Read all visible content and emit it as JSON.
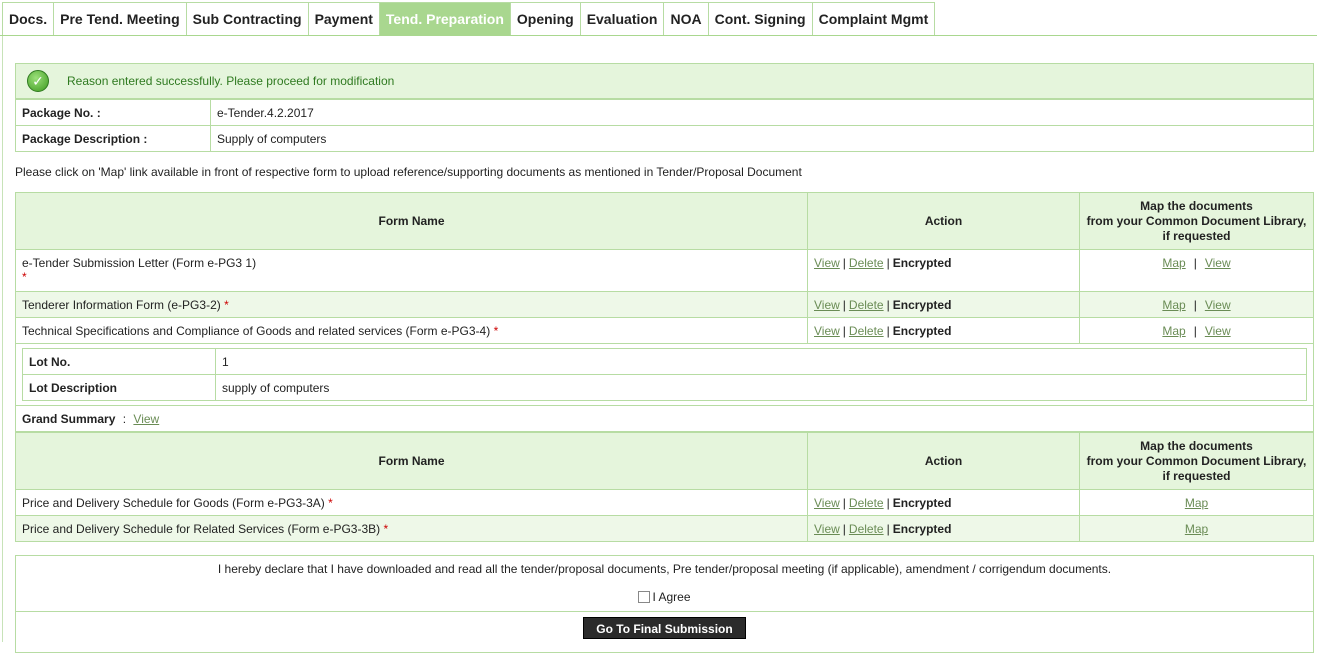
{
  "tabs": [
    "Docs.",
    "Pre Tend. Meeting",
    "Sub Contracting",
    "Payment",
    "Tend. Preparation",
    "Opening",
    "Evaluation",
    "NOA",
    "Cont. Signing",
    "Complaint Mgmt"
  ],
  "active_tab": "Tend. Preparation",
  "success_message": "Reason entered successfully. Please proceed for modification",
  "package": {
    "no_label": "Package No. :",
    "no_value": "e-Tender.4.2.2017",
    "desc_label": "Package Description :",
    "desc_value": "Supply of computers"
  },
  "instruction": "Please click on 'Map' link available in front of respective form to upload reference/supporting documents as mentioned in Tender/Proposal Document",
  "table_headers": {
    "form_name": "Form Name",
    "action": "Action",
    "map_line1": "Map the documents",
    "map_line2": "from your Common Document Library,",
    "map_line3": "if requested"
  },
  "links": {
    "view": "View",
    "delete": "Delete",
    "encrypted": "Encrypted",
    "map": "Map",
    "sep": "|",
    "required": "*"
  },
  "forms": [
    "e-Tender Submission Letter (Form e-PG3 1)",
    "Tenderer Information Form (e-PG3-2)",
    "Technical Specifications and Compliance of Goods and related services (Form e-PG3-4)"
  ],
  "lot": {
    "no_label": "Lot No.",
    "no_value": "1",
    "desc_label": "Lot Description",
    "desc_value": "supply of computers"
  },
  "grand_summary": {
    "label": "Grand Summary",
    "colon": ":",
    "link": "View"
  },
  "price_forms": [
    "Price and Delivery Schedule for Goods (Form e-PG3-3A)",
    "Price and Delivery Schedule for Related Services (Form e-PG3-3B)"
  ],
  "declaration": {
    "text": "I hereby declare that I have downloaded and read all the tender/proposal documents, Pre tender/proposal meeting (if applicable), amendment / corrigendum documents.",
    "agree_label": "I Agree",
    "agree_checked": false,
    "submit_label": "Go To Final Submission"
  },
  "colors": {
    "accent": "#a9d78f",
    "border": "#b7dca3",
    "header_bg": "#e5f5dc",
    "link": "#6a8c55",
    "success_text": "#2f7a20"
  }
}
